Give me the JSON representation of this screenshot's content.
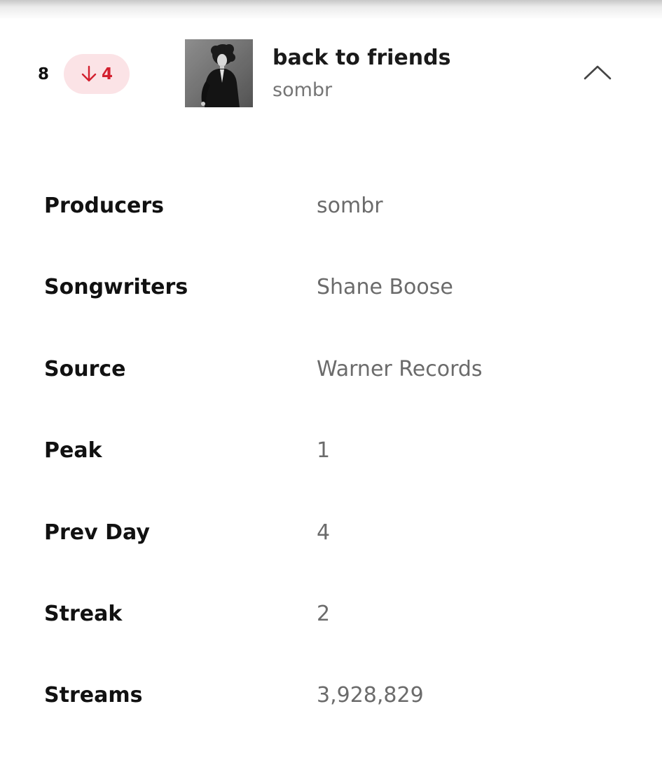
{
  "track": {
    "rank": "8",
    "change": {
      "direction_icon": "arrow-down-icon",
      "value": "4",
      "color": "#d3202f",
      "background": "#fbe3e6"
    },
    "title": "back to friends",
    "artist": "sombr",
    "expanded_icon": "chevron-up-icon"
  },
  "details": [
    {
      "label": "Producers",
      "value": "sombr"
    },
    {
      "label": "Songwriters",
      "value": "Shane Boose"
    },
    {
      "label": "Source",
      "value": "Warner Records"
    },
    {
      "label": "Peak",
      "value": "1"
    },
    {
      "label": "Prev Day",
      "value": "4"
    },
    {
      "label": "Streak",
      "value": "2"
    },
    {
      "label": "Streams",
      "value": "3,928,829"
    }
  ]
}
